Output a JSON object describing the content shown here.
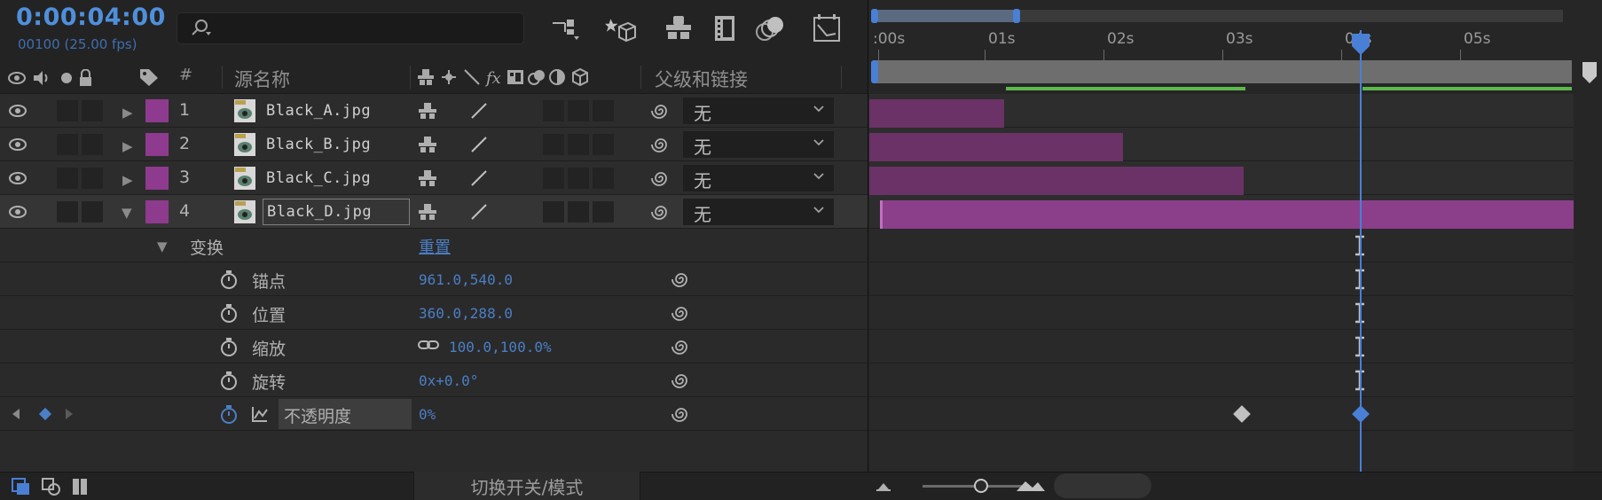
{
  "header": {
    "timecode": "0:00:04:00",
    "frames": "00100 (25.00 fps)",
    "search_placeholder": ""
  },
  "columns": {
    "number": "#",
    "source_name": "源名称",
    "parent_link": "父级和链接"
  },
  "layers": [
    {
      "num": "1",
      "name": "Black_A.jpg",
      "parent": "无"
    },
    {
      "num": "2",
      "name": "Black_B.jpg",
      "parent": "无"
    },
    {
      "num": "3",
      "name": "Black_C.jpg",
      "parent": "无"
    },
    {
      "num": "4",
      "name": "Black_D.jpg",
      "parent": "无"
    }
  ],
  "transform": {
    "label": "变换",
    "reset": "重置",
    "anchor": {
      "label": "锚点",
      "value": "961.0,540.0"
    },
    "position": {
      "label": "位置",
      "value": "360.0,288.0"
    },
    "scale": {
      "label": "缩放",
      "value": "100.0,100.0%"
    },
    "rotation": {
      "label": "旋转",
      "value": "0x+0.0°"
    },
    "opacity": {
      "label": "不透明度",
      "value": "0%"
    }
  },
  "ruler": {
    "labels": [
      ":00s",
      "01s",
      "02s",
      "03s",
      "04s",
      "05s"
    ]
  },
  "footer": {
    "mode_toggle": "切换开关/模式"
  },
  "colors": {
    "accent": "#4f8fdc",
    "layer_label": "#8e3a8e",
    "layer_bar": "#6a3266",
    "work_area": "#5db84a"
  }
}
